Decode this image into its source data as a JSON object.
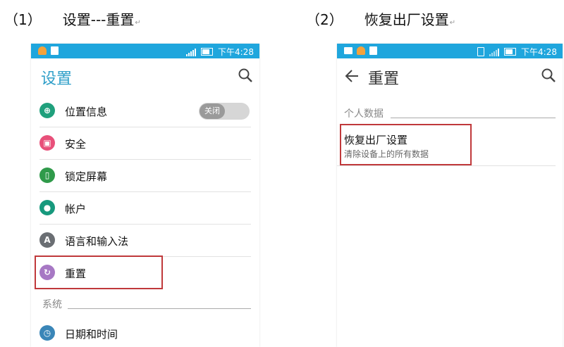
{
  "captions": [
    {
      "num": "（1）",
      "text": "设置---重置",
      "mark": "↵"
    },
    {
      "num": "（2）",
      "text": "恢复出厂设置",
      "mark": "↵"
    }
  ],
  "status": {
    "time": "下午4:28"
  },
  "left_screen": {
    "title": "设置",
    "items": [
      {
        "label": "位置信息",
        "icon": "location-icon",
        "color": "#1fa07c",
        "toggle": "关闭"
      },
      {
        "label": "安全",
        "icon": "lock-icon",
        "color": "#e8507a"
      },
      {
        "label": "锁定屏幕",
        "icon": "lock-screen-icon",
        "color": "#2f9a4a"
      },
      {
        "label": "帐户",
        "icon": "account-icon",
        "color": "#17997d"
      },
      {
        "label": "语言和输入法",
        "icon": "language-icon",
        "color": "#6a6e73",
        "glyph": "A"
      },
      {
        "label": "重置",
        "icon": "reset-icon",
        "color": "#a778c4"
      }
    ],
    "section": "系统",
    "after_section": [
      {
        "label": "日期和时间",
        "icon": "clock-icon",
        "color": "#3a86b8"
      }
    ]
  },
  "right_screen": {
    "title": "重置",
    "section": "个人数据",
    "item_title": "恢复出厂设置",
    "item_subtitle": "清除设备上的所有数据"
  },
  "colors": {
    "status_bar": "#1fa6dd",
    "accent": "#2f9fc9",
    "highlight": "#c0393b"
  }
}
